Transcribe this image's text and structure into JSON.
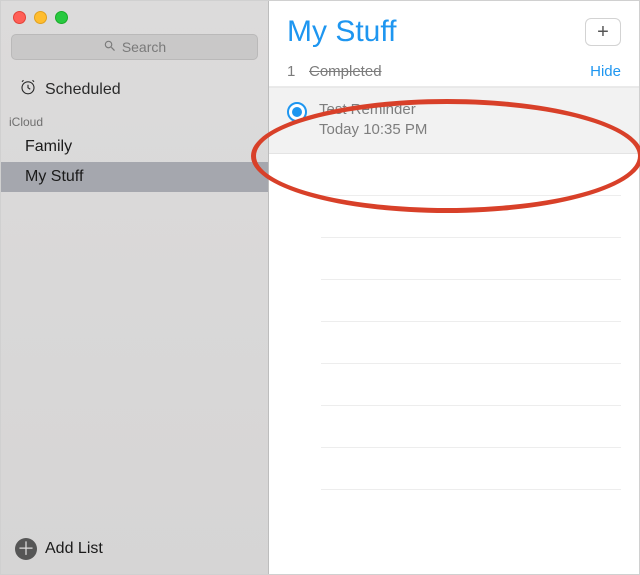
{
  "sidebar": {
    "search_placeholder": "Search",
    "scheduled_label": "Scheduled",
    "section_label": "iCloud",
    "lists": [
      {
        "name": "Family",
        "selected": false
      },
      {
        "name": "My Stuff",
        "selected": true
      }
    ],
    "add_list_label": "Add List"
  },
  "main": {
    "title": "My Stuff",
    "add_button": "+",
    "section": {
      "count": "1",
      "name": "Completed",
      "hide_label": "Hide"
    },
    "reminder": {
      "title": "Test Reminder",
      "subtitle": "Today 10:35 PM",
      "completed": true
    }
  }
}
